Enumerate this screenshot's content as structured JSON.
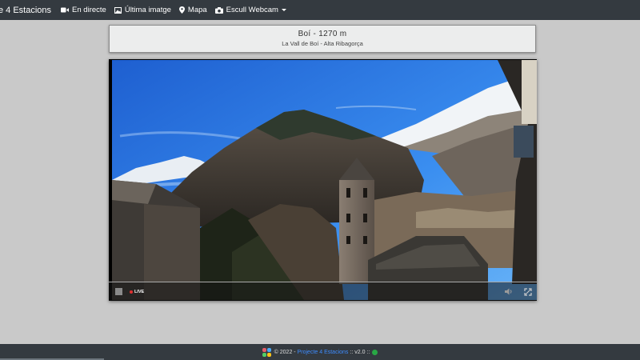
{
  "navbar": {
    "brand": "e 4 Estacions",
    "items": [
      {
        "label": "En directe",
        "icon": "video-camera-icon"
      },
      {
        "label": "Última imatge",
        "icon": "image-icon"
      },
      {
        "label": "Mapa",
        "icon": "map-pin-icon"
      },
      {
        "label": "Escull Webcam",
        "icon": "camera-icon"
      }
    ]
  },
  "title": {
    "main": "Boí - 1270 m",
    "sub": "La Vall de Boí - Alta Ribagorça"
  },
  "player": {
    "live_label": "LIVE",
    "controls": [
      "stop-icon",
      "volume-icon",
      "fullscreen-icon"
    ]
  },
  "footer": {
    "prefix": "© 2022 -",
    "link": "Projecte 4 Estacions",
    "version": ":: v2.0 ::",
    "status_color": "#28a745"
  },
  "colors": {
    "navbar_bg": "#343a40",
    "page_bg": "#c9c9c9",
    "accent_link": "#3d8bfd"
  }
}
